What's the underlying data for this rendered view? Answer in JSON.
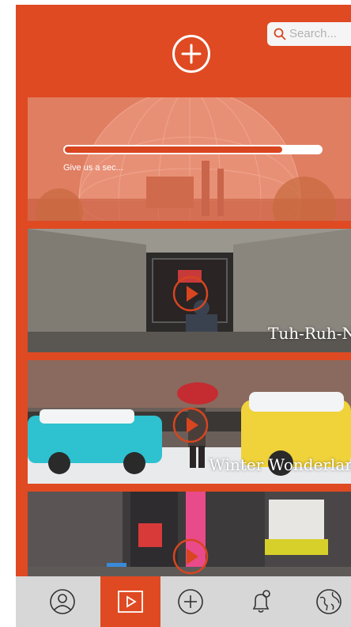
{
  "header": {
    "add_icon": "plus-circle-icon",
    "search": {
      "placeholder": "Search..."
    }
  },
  "feed": {
    "loading_card": {
      "progress": 0.85,
      "message": "Give us a sec..."
    },
    "cards": [
      {
        "title": "Tuh-Ruh-No",
        "icon": "play-icon"
      },
      {
        "title": "Winter Wonderland",
        "icon": "play-icon"
      },
      {
        "title": "",
        "icon": "play-icon"
      }
    ]
  },
  "nav": {
    "items": [
      {
        "icon": "profile-icon",
        "active": false
      },
      {
        "icon": "video-icon",
        "active": true
      },
      {
        "icon": "add-icon",
        "active": false
      },
      {
        "icon": "notification-icon",
        "active": false
      },
      {
        "icon": "globe-icon",
        "active": false
      }
    ]
  },
  "colors": {
    "accent": "#df4a22",
    "nav_background": "#d7d7d7",
    "search_background": "#f5f5f5"
  }
}
